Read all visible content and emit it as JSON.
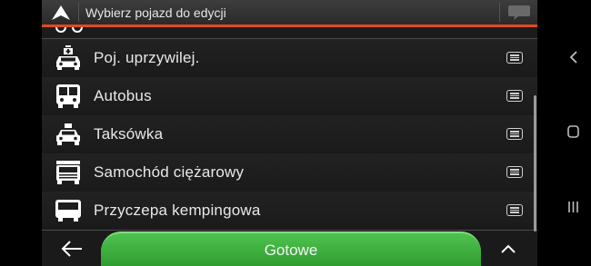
{
  "header": {
    "title": "Wybierz pojazd do edycji"
  },
  "vehicles": [
    {
      "label": "Poj. uprzywilej.",
      "icon": "emergency-vehicle-icon"
    },
    {
      "label": "Autobus",
      "icon": "bus-icon"
    },
    {
      "label": "Taksówka",
      "icon": "taxi-icon"
    },
    {
      "label": "Samochód ciężarowy",
      "icon": "truck-icon"
    },
    {
      "label": "Przyczepa kempingowa",
      "icon": "camper-icon"
    }
  ],
  "footer": {
    "done_label": "Gotowe"
  },
  "colors": {
    "accent": "#e2491b",
    "done_button": "#3aad3a"
  }
}
